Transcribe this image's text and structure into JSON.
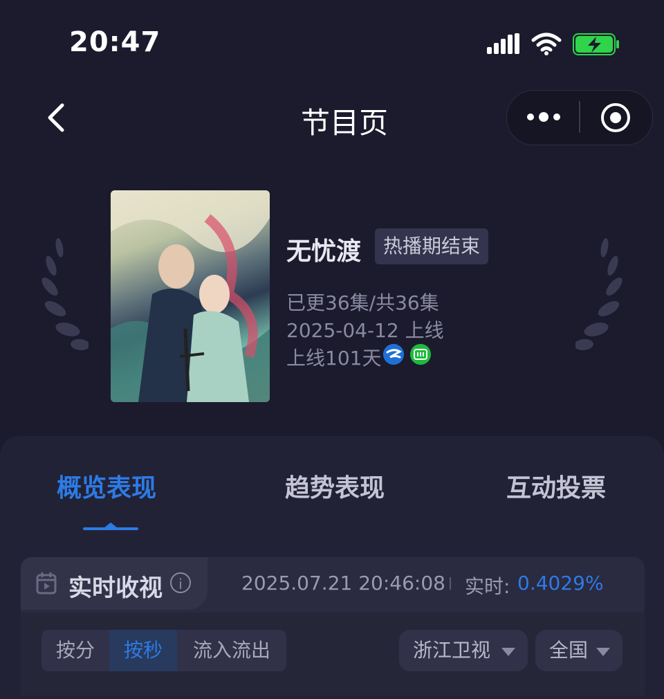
{
  "status_bar": {
    "time": "20:47"
  },
  "nav": {
    "title": "节目页"
  },
  "program": {
    "name": "无忧渡",
    "badge": "热播期结束",
    "episodes": "已更36集/共36集",
    "launch_date": "2025-04-12 上线",
    "days_online": "上线101天",
    "platform_icons": [
      "zhejiang-tv-icon",
      "iqiyi-icon"
    ]
  },
  "tabs": [
    {
      "label": "概览表现",
      "active": true
    },
    {
      "label": "趋势表现",
      "active": false
    },
    {
      "label": "互动投票",
      "active": false
    }
  ],
  "realtime": {
    "label": "实时收视",
    "info_glyph": "i",
    "timestamp": "2025.07.21 20:46:08",
    "value_prefix": "实时:",
    "value": "0.4029%"
  },
  "controls": {
    "segments": [
      {
        "label": "按分",
        "selected": false
      },
      {
        "label": "按秒",
        "selected": true
      },
      {
        "label": "流入流出",
        "selected": false
      }
    ],
    "channel_dropdown": "浙江卫视",
    "region_dropdown": "全国"
  },
  "colors": {
    "background": "#1b1b2d",
    "accent": "#2d7be5",
    "panel": "#222236"
  }
}
